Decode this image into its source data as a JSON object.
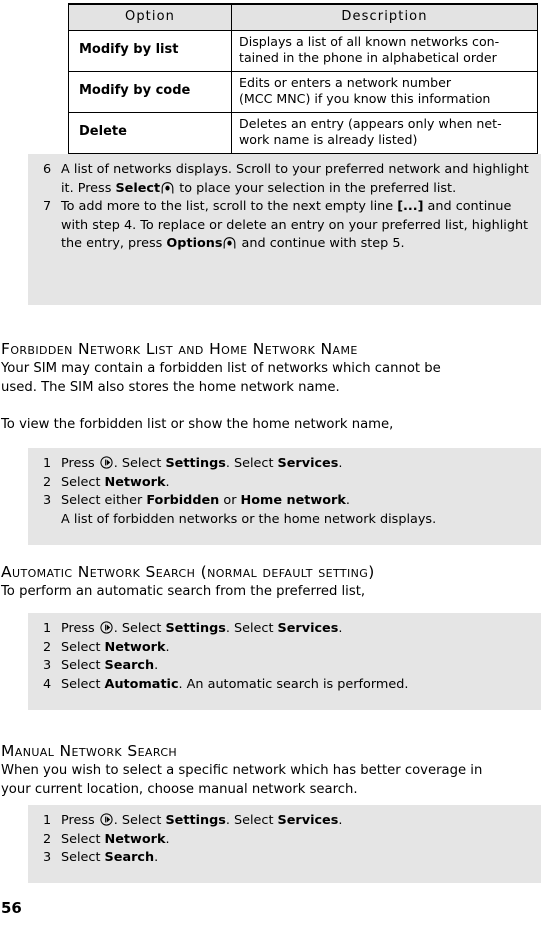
{
  "options_table": {
    "headers": [
      "Option",
      "Description"
    ],
    "rows": [
      {
        "option": "Modify by list",
        "description_lines": [
          "Displays a list of all known networks con-",
          "tained in the phone in alphabetical order"
        ]
      },
      {
        "option": "Modify by code",
        "description_lines": [
          "Edits or enters a network number",
          "(MCC MNC) if you know this information"
        ]
      },
      {
        "option": "Delete",
        "description_lines": [
          "Deletes an entry (appears only when net-",
          "work name is already listed)"
        ]
      }
    ]
  },
  "procedure_top": {
    "steps": [
      {
        "num": "6",
        "seg1": "A list of networks displays. Scroll to your preferred network and highlight it. Press ",
        "bold1": "Select",
        "icon": "softkey-icon",
        "seg2": " to place your selection in the preferred list.",
        "bold2": "",
        "seg3": ""
      },
      {
        "num": "7",
        "seg1": "To add more to the list, scroll to the next empty line ",
        "bold1": "[...]",
        "icon": "none",
        "seg2": " and continue with step 4. To replace or delete an entry on your preferred list, highlight the entry, press ",
        "bold2": "Options",
        "seg3": " and continue with step 5."
      }
    ]
  },
  "section_forbidden": {
    "heading": "Forbidden Network List and Home Network Name",
    "para_lines": [
      "Your SIM may contain a forbidden list of networks which cannot be",
      "used. The SIM also stores the home network name."
    ],
    "lead_in": "To view the forbidden list or show the home network name,",
    "steps": [
      {
        "num": "1",
        "pre": "Press ",
        "icon": "menu-key-icon",
        "mid": ". Select  ",
        "b1": "Settings",
        "mid2": ". Select  ",
        "b2": "Services",
        "post": "."
      },
      {
        "num": "2",
        "pre": "Select  ",
        "icon": "none",
        "mid": "",
        "b1": "Network",
        "mid2": "",
        "b2": "",
        "post": "."
      },
      {
        "num": "3",
        "pre": "Select either  ",
        "icon": "none",
        "mid": "",
        "b1": "Forbidden",
        "mid2": " or  ",
        "b2": "Home network",
        "post": ".",
        "extra_line": "A list of forbidden networks or the home network displays."
      }
    ]
  },
  "section_automatic": {
    "heading": "Automatic Network Search (normal default setting)",
    "lead_in": "To perform an automatic search from the preferred list,",
    "steps": [
      {
        "num": "1",
        "pre": "Press ",
        "icon": "menu-key-icon",
        "mid": ". Select  ",
        "b1": "Settings",
        "mid2": ". Select  ",
        "b2": "Services",
        "post": "."
      },
      {
        "num": "2",
        "pre": "Select  ",
        "icon": "none",
        "mid": "",
        "b1": "Network",
        "mid2": "",
        "b2": "",
        "post": "."
      },
      {
        "num": "3",
        "pre": "Select  ",
        "icon": "none",
        "mid": "",
        "b1": "Search",
        "mid2": "",
        "b2": "",
        "post": "."
      },
      {
        "num": "4",
        "pre": "Select  ",
        "icon": "none",
        "mid": "",
        "b1": "Automatic",
        "mid2": "",
        "b2": "",
        "post": ". An automatic search is performed."
      }
    ]
  },
  "section_manual": {
    "heading": "Manual Network Search",
    "para_lines": [
      "When you wish to select a specific network which has better coverage in",
      "your current location, choose manual network search."
    ],
    "steps": [
      {
        "num": "1",
        "pre": "Press ",
        "icon": "menu-key-icon",
        "mid": ". Select  ",
        "b1": "Settings",
        "mid2": ". Select  ",
        "b2": "Services",
        "post": "."
      },
      {
        "num": "2",
        "pre": "Select  ",
        "icon": "none",
        "mid": "",
        "b1": "Network",
        "mid2": "",
        "b2": "",
        "post": "."
      },
      {
        "num": "3",
        "pre": "Select  ",
        "icon": "none",
        "mid": "",
        "b1": "Search",
        "mid2": "",
        "b2": "",
        "post": "."
      }
    ]
  },
  "page_number": "56",
  "colors": {
    "shade": "#e5e5e5",
    "table_header": "#e3e3e3",
    "text": "#000000",
    "page_bg": "#ffffff"
  }
}
